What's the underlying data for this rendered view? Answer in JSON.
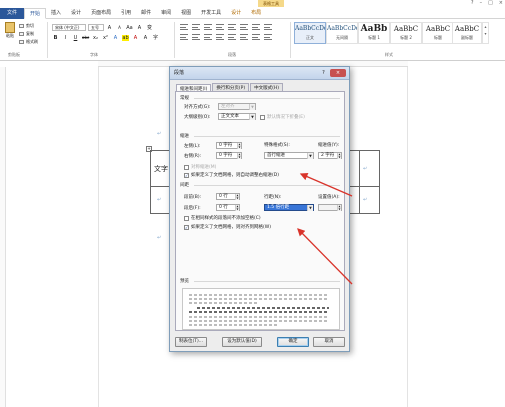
{
  "window": {
    "context_tab_group": "表格工具",
    "controls": [
      "?",
      "–",
      "□",
      "×"
    ]
  },
  "tabs": [
    "开始",
    "插入",
    "设计",
    "页面布局",
    "引用",
    "邮件",
    "审阅",
    "视图",
    "开发工具",
    "设计",
    "布局"
  ],
  "file_tab": "文件",
  "ribbon": {
    "clipboard": {
      "paste": "粘贴",
      "cut": "剪切",
      "copy": "复制",
      "format_painter": "格式刷",
      "group": "剪贴板"
    },
    "font": {
      "name": "宋体 (中文正)",
      "size": "五号",
      "grow": "A",
      "shrink": "A",
      "aa": "Aa",
      "clear": "A",
      "wen": "变",
      "group": "字体"
    },
    "format_buttons": [
      "B",
      "I",
      "U",
      "abc",
      "x₂",
      "x²",
      "A",
      "ab",
      "A",
      "A",
      "字"
    ],
    "paragraph": {
      "group": "段落"
    },
    "styles": {
      "items": [
        {
          "sample": "AaBbCcDd",
          "name": "正文"
        },
        {
          "sample": "AaBbCcDd",
          "name": "无间隔"
        },
        {
          "sample": "AaBb",
          "name": "标题 1"
        },
        {
          "sample": "AaBbC",
          "name": "标题 2"
        },
        {
          "sample": "AaBbC",
          "name": "标题"
        },
        {
          "sample": "AaBbC",
          "name": "副标题"
        }
      ],
      "group": "样式"
    }
  },
  "document": {
    "table_cells": [
      [
        "文字",
        "",
        "↵"
      ],
      [
        "",
        "",
        "↵"
      ]
    ],
    "para_mark": "↵"
  },
  "dialog": {
    "title": "段落",
    "help": "?",
    "close": "×",
    "tabs": [
      "缩进和间距(I)",
      "换行和分页(P)",
      "中文版式(H)"
    ],
    "general": {
      "head": "常规",
      "alignment_label": "对齐方式(G):",
      "alignment_value": "左对齐",
      "outline_label": "大纲级别(O):",
      "outline_value": "正文文本",
      "collapsed_label": "默认情况下折叠(E)"
    },
    "indent": {
      "head": "缩进",
      "left_label": "左侧(L):",
      "left_value": "0 字符",
      "right_label": "右侧(R):",
      "right_value": "0 字符",
      "special_label": "特殊格式(S):",
      "special_value": "首行缩进",
      "by_label": "缩进值(Y):",
      "by_value": "2 字符",
      "mirror_label": "对称缩进(M)",
      "auto_adjust_label": "如果定义了文档网格，则自动调整右缩进(D)"
    },
    "spacing": {
      "head": "间距",
      "before_label": "段前(B):",
      "before_value": "0 行",
      "after_label": "段后(F):",
      "after_value": "0 行",
      "line_label": "行距(N):",
      "line_value": "1.5 倍行距",
      "at_label": "设置值(A):",
      "at_value": "",
      "no_space_label": "在相同样式的段落间不添加空格(C)",
      "snap_grid_label": "如果定义了文档网格，则对齐到网格(W)"
    },
    "preview": {
      "head": "预览"
    },
    "buttons": {
      "tabs": "制表位(T)...",
      "default": "设为默认值(D)",
      "ok": "确定",
      "cancel": "取消"
    }
  },
  "annotation_color": "#d9342b"
}
